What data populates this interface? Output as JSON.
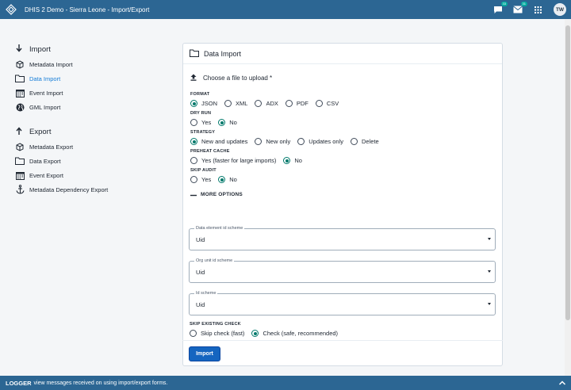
{
  "header": {
    "title": "DHIS 2 Demo - Sierra Leone - Import/Export",
    "interpretations_badge": "33",
    "messages_badge": "31",
    "avatar": "TW"
  },
  "sidebar": {
    "import_title": "Import",
    "import_items": [
      {
        "label": "Metadata Import",
        "icon": "cubes-icon"
      },
      {
        "label": "Data Import",
        "icon": "folder-icon",
        "active": true
      },
      {
        "label": "Event Import",
        "icon": "calendar-icon"
      },
      {
        "label": "GML Import",
        "icon": "globe-icon"
      }
    ],
    "export_title": "Export",
    "export_items": [
      {
        "label": "Metadata Export",
        "icon": "cubes-icon"
      },
      {
        "label": "Data Export",
        "icon": "folder-icon"
      },
      {
        "label": "Event Export",
        "icon": "calendar-icon"
      },
      {
        "label": "Metadata Dependency Export",
        "icon": "anchor-icon"
      }
    ]
  },
  "card": {
    "title": "Data Import",
    "upload_label": "Choose a file to upload *",
    "format": {
      "label": "FORMAT",
      "options": [
        "JSON",
        "XML",
        "ADX",
        "PDF",
        "CSV"
      ],
      "selected": "JSON"
    },
    "dry_run": {
      "label": "DRY RUN",
      "options": [
        "Yes",
        "No"
      ],
      "selected": "No"
    },
    "strategy": {
      "label": "STRATEGY",
      "options": [
        "New and updates",
        "New only",
        "Updates only",
        "Delete"
      ],
      "selected": "New and updates"
    },
    "preheat_cache": {
      "label": "PREHEAT CACHE",
      "options": [
        "Yes (faster for large imports)",
        "No"
      ],
      "selected": "No"
    },
    "skip_audit": {
      "label": "SKIP AUDIT",
      "options": [
        "Yes",
        "No"
      ],
      "selected": "No"
    },
    "more_options": "MORE OPTIONS",
    "selects": [
      {
        "label": "Data element id scheme",
        "value": "Uid"
      },
      {
        "label": "Org unit id scheme",
        "value": "Uid"
      },
      {
        "label": "Id scheme",
        "value": "Uid"
      }
    ],
    "skip_existing_check": {
      "label": "SKIP EXISTING CHECK",
      "options": [
        "Skip check (fast)",
        "Check (safe, recommended)"
      ],
      "selected": "Check (safe, recommended)"
    },
    "import_button": "Import"
  },
  "logger": {
    "tag": "LOGGER",
    "message": "view messages received on using import/export forms."
  },
  "colors": {
    "header_bg": "#2c6693",
    "accent_blue": "#1565c0",
    "radio_selected": "#00796b",
    "active_link": "#147cd7"
  }
}
